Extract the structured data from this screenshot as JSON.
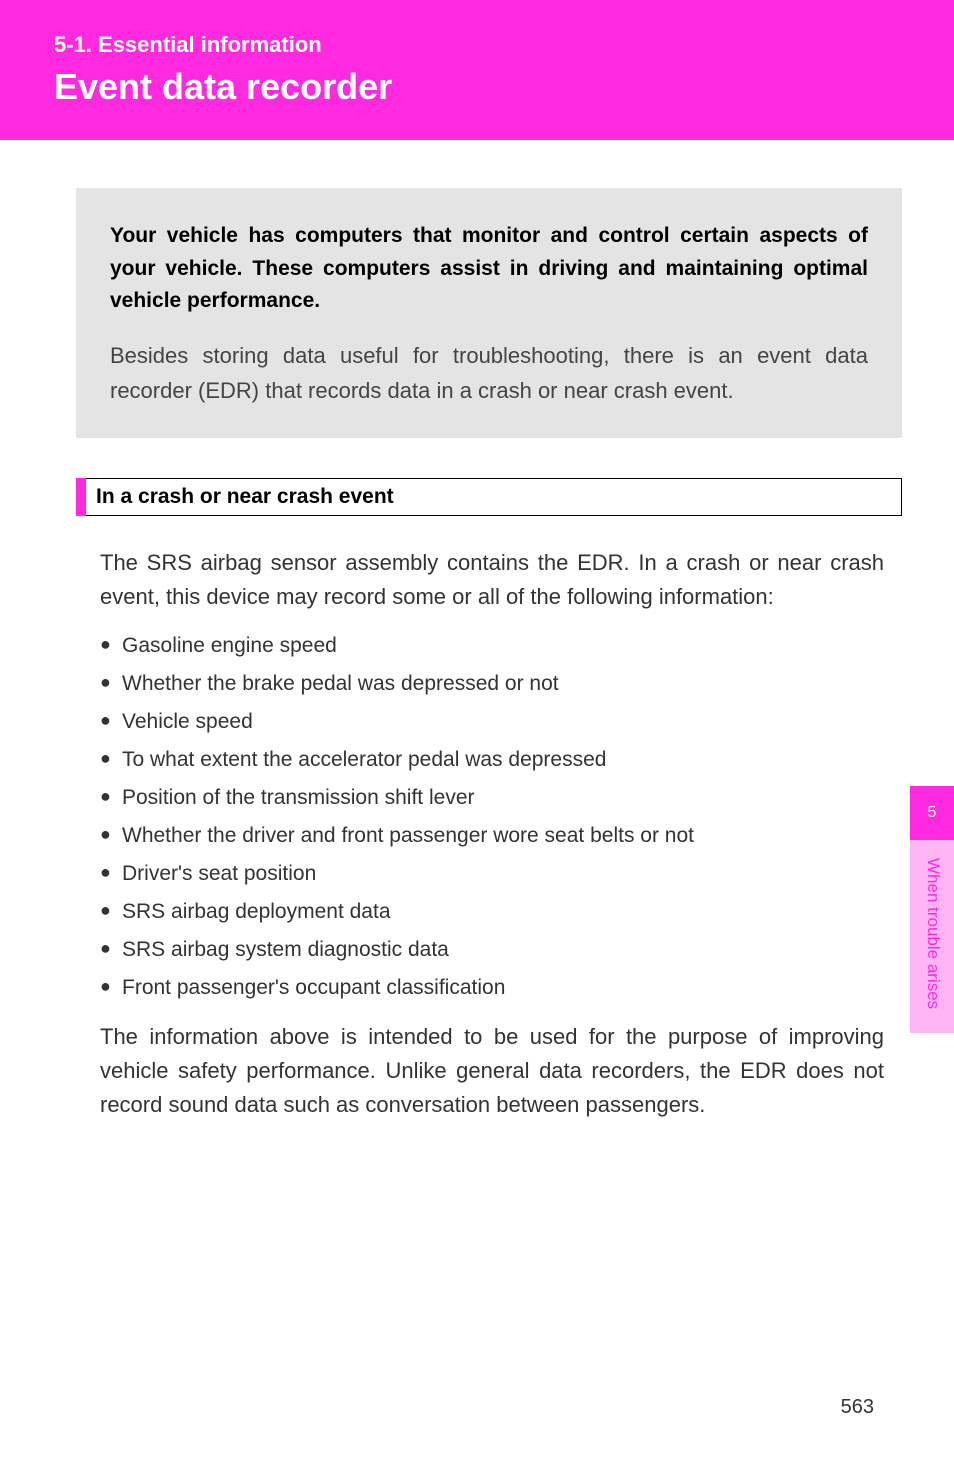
{
  "header": {
    "section_label": "5-1. Essential information",
    "title": "Event data recorder"
  },
  "intro": {
    "bold": "Your vehicle has computers that monitor and control certain aspects of your vehicle. These computers assist in driving and maintaining optimal vehicle performance.",
    "normal": "Besides storing data useful for troubleshooting, there is an event data recorder (EDR) that records data in a crash or near crash event."
  },
  "subsection": {
    "title": "In a crash or near crash event"
  },
  "body": {
    "para1": "The SRS airbag sensor assembly contains the EDR. In a crash or near crash event, this device may record some or all of the following information:",
    "bullets": [
      "Gasoline engine speed",
      "Whether the brake pedal was depressed or not",
      "Vehicle speed",
      "To what extent the accelerator pedal was depressed",
      "Position of the transmission shift lever",
      "Whether the driver and front passenger wore seat belts or not",
      "Driver's seat position",
      "SRS airbag deployment data",
      "SRS airbag system diagnostic data",
      "Front passenger's occupant classification"
    ],
    "para2": "The information above is intended to be used for the purpose of improving vehicle safety performance. Unlike general data recorders, the EDR does not record sound data such as conversation between passengers."
  },
  "sidebar": {
    "chapter_num": "5",
    "chapter_label": "When trouble arises"
  },
  "page_number": "563"
}
